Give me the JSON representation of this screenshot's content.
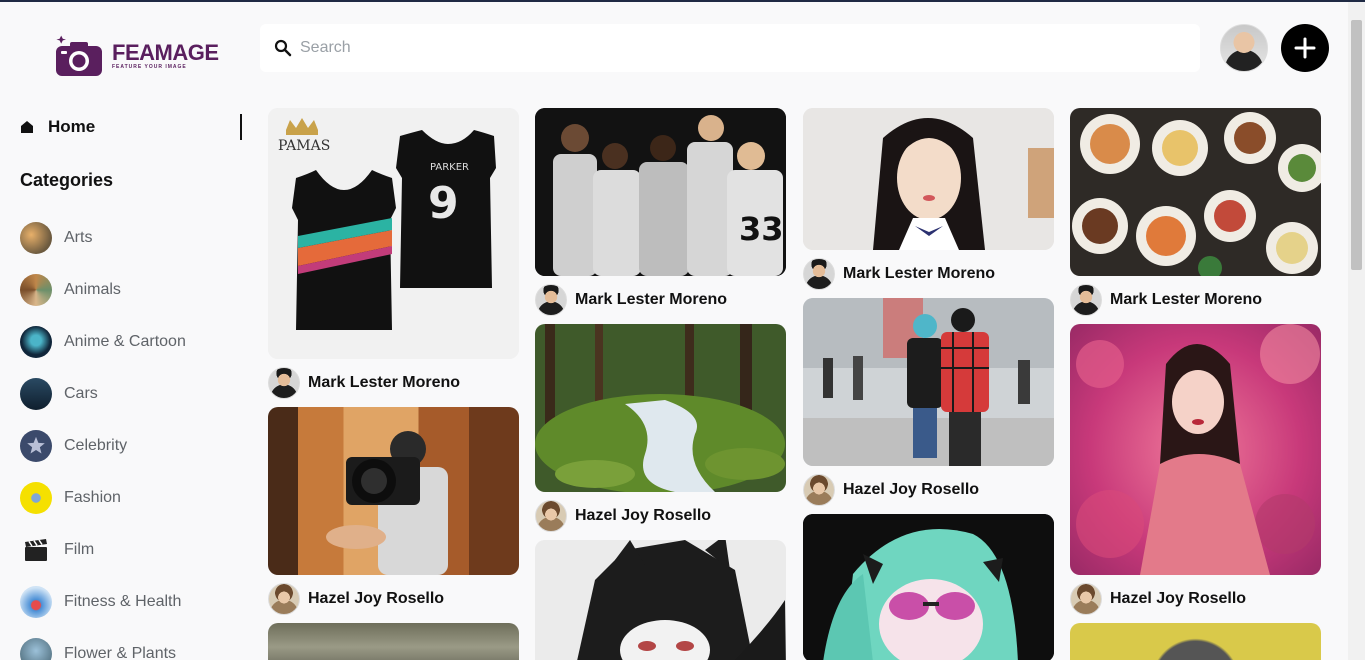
{
  "app": {
    "logo_title": "FEAMAGE",
    "logo_tagline": "FEATURE YOUR IMAGE",
    "brand_color": "#5a1f5e"
  },
  "search": {
    "placeholder": "Search",
    "value": ""
  },
  "nav": {
    "home_label": "Home"
  },
  "categories": {
    "title": "Categories",
    "items": [
      {
        "label": "Arts",
        "icon": "arts-thumbnail"
      },
      {
        "label": "Animals",
        "icon": "animals-thumbnail"
      },
      {
        "label": "Anime & Cartoon",
        "icon": "anime-thumbnail"
      },
      {
        "label": "Cars",
        "icon": "cars-thumbnail"
      },
      {
        "label": "Celebrity",
        "icon": "celebrity-thumbnail"
      },
      {
        "label": "Fashion",
        "icon": "fashion-thumbnail"
      },
      {
        "label": "Film",
        "icon": "film-thumbnail"
      },
      {
        "label": "Fitness & Health",
        "icon": "fitness-thumbnail"
      },
      {
        "label": "Flower & Plants",
        "icon": "flower-thumbnail"
      }
    ]
  },
  "feed": {
    "columns": [
      [
        {
          "image": "jersey-photo",
          "author": "Mark Lester Moreno",
          "brand_text": "PAMAS"
        },
        {
          "image": "camera-photographer-photo",
          "author": "Hazel Joy Rosello"
        },
        {
          "image": "road-photo",
          "author": ""
        }
      ],
      [
        {
          "image": "basketball-team-photo",
          "author": "Mark Lester Moreno"
        },
        {
          "image": "forest-stream-photo",
          "author": "Hazel Joy Rosello"
        },
        {
          "image": "anime-boy-photo",
          "author": ""
        }
      ],
      [
        {
          "image": "portrait-girl-photo",
          "author": "Mark Lester Moreno"
        },
        {
          "image": "street-fashion-photo",
          "author": "Hazel Joy Rosello"
        },
        {
          "image": "anime-girl-photo",
          "author": ""
        }
      ],
      [
        {
          "image": "food-table-photo",
          "author": "Mark Lester Moreno"
        },
        {
          "image": "floral-portrait-photo",
          "author": "Hazel Joy Rosello"
        },
        {
          "image": "cat-photo",
          "author": ""
        }
      ]
    ]
  }
}
